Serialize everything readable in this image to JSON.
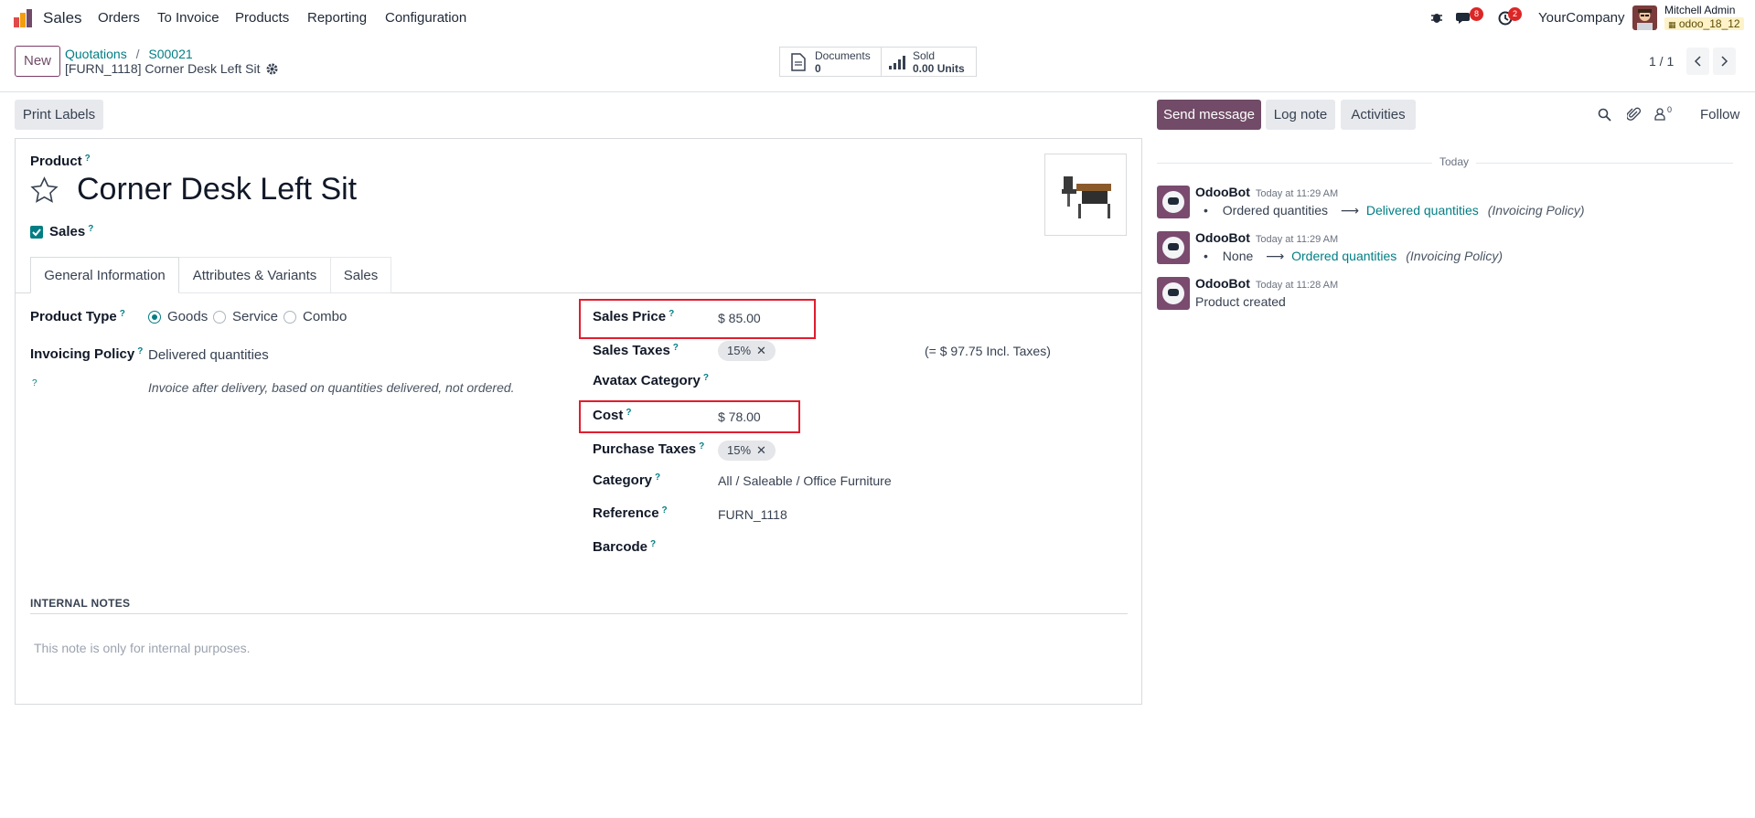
{
  "navbar": {
    "app_name": "Sales",
    "menu": [
      "Orders",
      "To Invoice",
      "Products",
      "Reporting",
      "Configuration"
    ],
    "messages_count": "8",
    "activities_count": "2",
    "company": "YourCompany",
    "user_name": "Mitchell Admin",
    "db_name": "odoo_18_12"
  },
  "control": {
    "new_label": "New",
    "breadcrumb": [
      "Quotations",
      "S00021"
    ],
    "record_title": "[FURN_1118] Corner Desk Left Sit",
    "stat_documents": {
      "label": "Documents",
      "value": "0"
    },
    "stat_sold": {
      "label": "Sold",
      "value": "0.00 Units"
    },
    "pager": "1 / 1"
  },
  "actions": {
    "print_labels": "Print Labels"
  },
  "chatter": {
    "send_message": "Send message",
    "log_note": "Log note",
    "activities": "Activities",
    "followers_count": "0",
    "follow": "Follow",
    "date_separator": "Today",
    "messages": [
      {
        "author": "OdooBot",
        "time": "Today at 11:29 AM",
        "old": "Ordered quantities",
        "new": "Delivered quantities",
        "field": "(Invoicing Policy)"
      },
      {
        "author": "OdooBot",
        "time": "Today at 11:29 AM",
        "old": "None",
        "new": "Ordered quantities",
        "field": "(Invoicing Policy)"
      },
      {
        "author": "OdooBot",
        "time": "Today at 11:28 AM",
        "body": "Product created"
      }
    ]
  },
  "form": {
    "product_label": "Product",
    "product_name": "Corner Desk Left Sit",
    "sales_checkbox_label": "Sales",
    "tabs": [
      "General Information",
      "Attributes & Variants",
      "Sales"
    ],
    "product_type": {
      "label": "Product Type",
      "options": [
        "Goods",
        "Service",
        "Combo"
      ],
      "selected": "Goods"
    },
    "invoicing_policy": {
      "label": "Invoicing Policy",
      "value": "Delivered quantities",
      "help": "Invoice after delivery, based on quantities delivered, not ordered."
    },
    "sales_price": {
      "label": "Sales Price",
      "value": "$ 85.00"
    },
    "sales_taxes": {
      "label": "Sales Taxes",
      "tag": "15%",
      "incl": "(= $ 97.75 Incl. Taxes)"
    },
    "avatax_category": {
      "label": "Avatax Category"
    },
    "cost": {
      "label": "Cost",
      "value": "$ 78.00"
    },
    "purchase_taxes": {
      "label": "Purchase Taxes",
      "tag": "15%"
    },
    "category": {
      "label": "Category",
      "value": "All / Saleable / Office Furniture"
    },
    "reference": {
      "label": "Reference",
      "value": "FURN_1118"
    },
    "barcode": {
      "label": "Barcode"
    },
    "internal_notes": {
      "heading": "INTERNAL NOTES",
      "placeholder": "This note is only for internal purposes."
    }
  },
  "colors": {
    "brand": "#714b67",
    "teal": "#017e84",
    "highlight_red": "#e11d2e"
  }
}
